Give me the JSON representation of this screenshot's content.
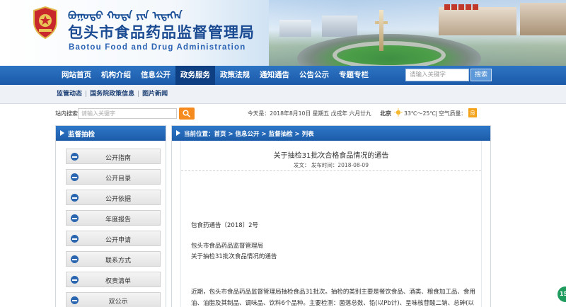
{
  "header": {
    "mongolian_text": "ᠪᠣᠭᠣᠲᠣ ᠬᠣᠲᠠ ᠶᠢᠨ ᠢᠳᠡᠭᠡᠨ",
    "title": "包头市食品药品监督管理局",
    "subtitle": "Baotou Food and Drug Administration"
  },
  "mainnav": {
    "items": [
      "网站首页",
      "机构介绍",
      "信息公开",
      "政务服务",
      "政策法规",
      "通知通告",
      "公告公示",
      "专题专栏"
    ],
    "active": "政务服务",
    "search_placeholder": "请输入关键字",
    "search_button": "搜索"
  },
  "subnav": {
    "links": [
      "监管动态",
      "国务院政策信息",
      "图片新闻"
    ],
    "separator": "|"
  },
  "utilbar": {
    "search_label": "站内搜索：",
    "search_placeholder": "请输入关键字",
    "date": "今天是：2018年8月10日 星期五 戊戌年 六月廿九",
    "city": "北京",
    "temperature": "33℃～25℃",
    "air_quality_label": "| 空气质量：",
    "air_quality_value": "良",
    "air_quality_color": "#f2a31a"
  },
  "sidebar": {
    "title": "监督抽检",
    "items": [
      "公开指南",
      "公开目录",
      "公开依据",
      "年度报告",
      "公开申请",
      "联系方式",
      "权责清单",
      "双公示"
    ]
  },
  "content": {
    "breadcrumb": "当前位置：首页 > 信息公开 > 监督抽检 > 列表",
    "article_title": "关于抽检31批次合格食品情况的通告",
    "meta": "发文：     发布时间：2018-08-09",
    "doc_number": "包食药通告〔2018〕2号",
    "addressee": "包头市食品药品监督管理局",
    "subject": "关于抽检31批次食品情况的通告",
    "paragraph": "近期，包头市食品药品监督管理局抽检食品31批次。抽检的类别主要是餐饮食品、酒类、粮食加工品、食用油、油脂及其制品、调味品、饮料6个品种。主要检测：菌落总数、铅(以Pb计)、呈味核苷酸二钠、总砷(以"
  },
  "floating_badge": "15",
  "colors": {
    "nav_blue": "#1b5aa8",
    "nav_active": "#0d3f82",
    "title_blue": "#1a4a92",
    "search_orange": "#f58a1e"
  }
}
